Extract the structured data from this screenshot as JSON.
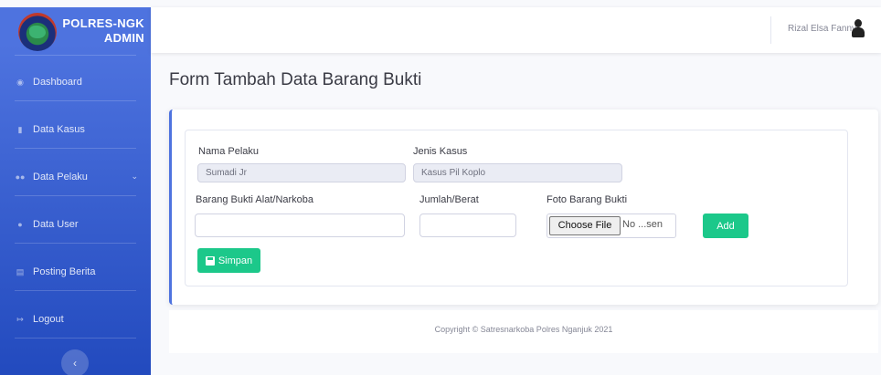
{
  "brand": {
    "line1": "POLRES-NGK",
    "line2": "ADMIN"
  },
  "sidebar": {
    "items": [
      {
        "label": "Dashboard",
        "icon": "tachometer-icon"
      },
      {
        "label": "Data Kasus",
        "icon": "file-icon"
      },
      {
        "label": "Data Pelaku",
        "icon": "users-icon",
        "chevron": "⌄"
      },
      {
        "label": "Data User",
        "icon": "user-icon"
      },
      {
        "label": "Posting Berita",
        "icon": "newspaper-icon"
      },
      {
        "label": "Logout",
        "icon": "sign-out-icon"
      }
    ],
    "toggle": "‹"
  },
  "topbar": {
    "username": "Rizal Elsa Fanny"
  },
  "page": {
    "title": "Form Tambah Data Barang Bukti"
  },
  "form": {
    "nama_pelaku_label": "Nama Pelaku",
    "nama_pelaku_value": "Sumadi Jr",
    "jenis_kasus_label": "Jenis Kasus",
    "jenis_kasus_value": "Kasus Pil Koplo",
    "barang_label": "Barang Bukti Alat/Narkoba",
    "barang_value": "",
    "jumlah_label": "Jumlah/Berat",
    "jumlah_value": "",
    "foto_label": "Foto Barang Bukti",
    "file_button": "Choose File",
    "file_status": "No ...sen",
    "add_button": "Add",
    "save_button": "Simpan"
  },
  "footer": {
    "copyright": "Copyright © Satresnarkoba Polres Nganjuk 2021"
  },
  "colors": {
    "primary": "#4e73df",
    "success": "#1cc88a",
    "background": "#f8f9fc"
  }
}
